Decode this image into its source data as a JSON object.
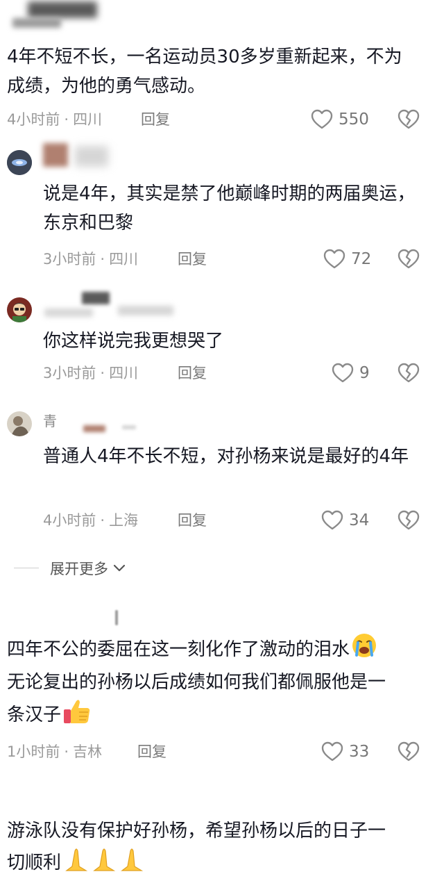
{
  "comments": [
    {
      "text": "4年不短不长，一名运动员30多岁重新起来，不为成绩，为他的勇气感动。",
      "time": "4小时前",
      "location": "四川",
      "reply": "回复",
      "likes": "550"
    }
  ],
  "replies": [
    {
      "text": "说是4年，其实是禁了他巅峰时期的两届奥运，东京和巴黎",
      "time": "3小时前",
      "location": "四川",
      "reply": "回复",
      "likes": "72"
    },
    {
      "text": "你这样说完我更想哭了",
      "time": "3小时前",
      "location": "四川",
      "reply": "回复",
      "likes": "9"
    },
    {
      "username_fragment": "青",
      "text": "普通人4年不长不短，对孙杨来说是最好的4年",
      "time": "4小时前",
      "location": "上海",
      "reply": "回复",
      "likes": "34"
    }
  ],
  "expand_more": "展开更多",
  "comment2": {
    "line1": "四年不公的委屈在这一刻化作了激动的泪水",
    "line2": "无论复出的孙杨以后成绩如何我们都佩服他是一",
    "line3": "条汉子",
    "time": "1小时前",
    "location": "吉林",
    "reply": "回复",
    "likes": "33"
  },
  "comment3": {
    "line1": "游泳队没有保护好孙杨，希望孙杨以后的日子一",
    "line2": "切顺利"
  },
  "separator_dot": "·",
  "colors": {
    "text": "#161823",
    "meta": "#9a9a9a",
    "icon": "#8a8a8a"
  },
  "icons": {
    "like": "heart-outline-icon",
    "dislike": "broken-heart-icon",
    "expand": "chevron-down-icon",
    "crying": "loudly-crying-face-emoji",
    "thumbs": "thumbs-up-emoji",
    "pray": "folded-hands-emoji"
  }
}
